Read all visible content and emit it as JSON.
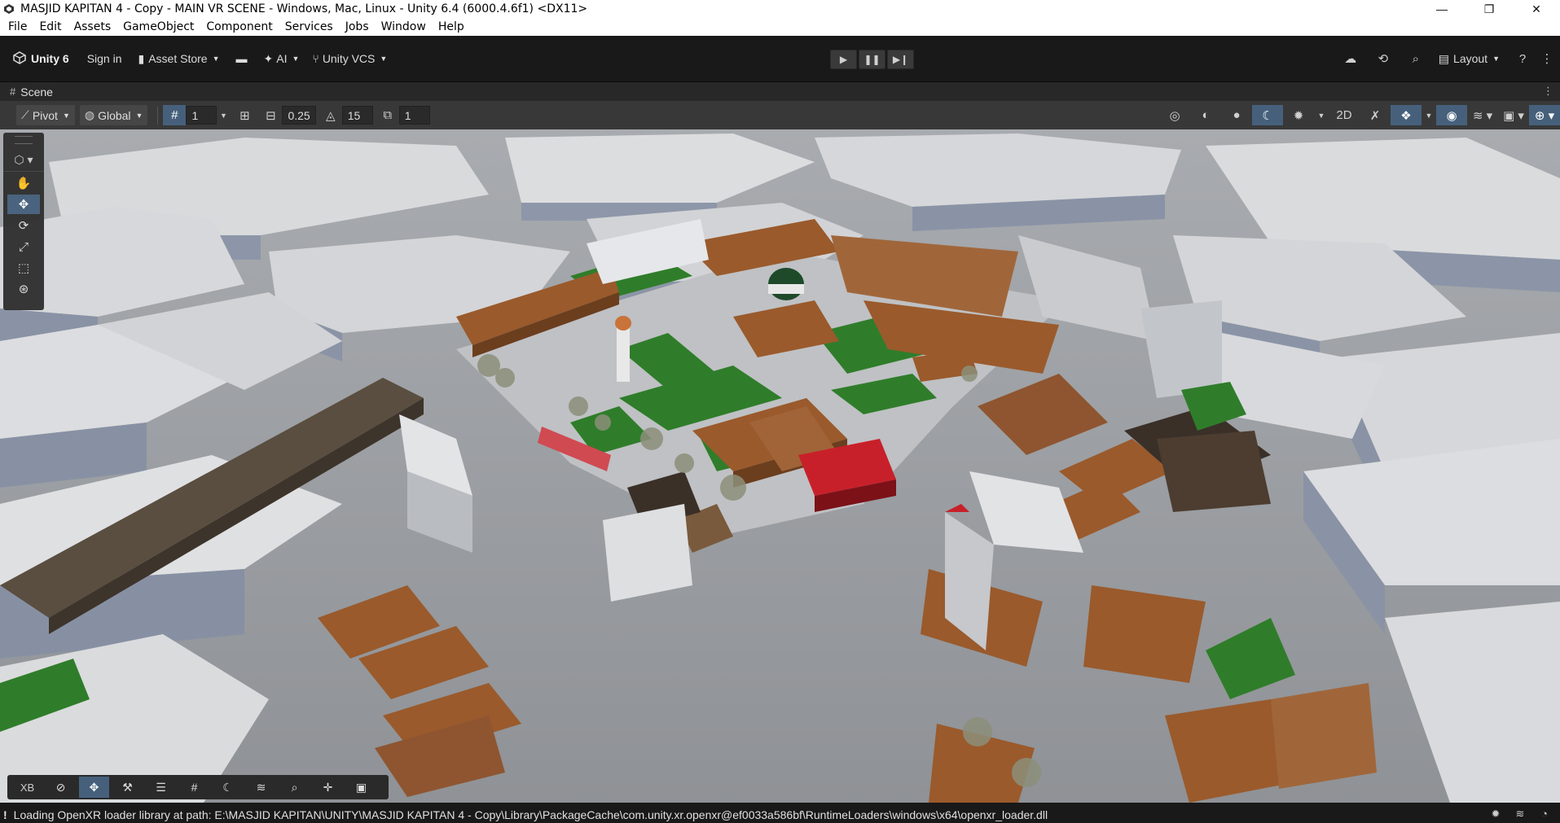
{
  "window": {
    "title": "MASJID KAPITAN 4 - Copy - MAIN VR SCENE - Windows, Mac, Linux - Unity 6.4 (6000.4.6f1) <DX11>",
    "minimize": "—",
    "maximize": "❐",
    "close": "✕"
  },
  "menu": {
    "items": [
      "File",
      "Edit",
      "Assets",
      "GameObject",
      "Component",
      "Services",
      "Jobs",
      "Window",
      "Help"
    ]
  },
  "toolbar": {
    "unity_label": "Unity 6",
    "sign_in": "Sign in",
    "asset_store": "Asset Store",
    "ai": "AI",
    "vcs": "Unity VCS",
    "layout": "Layout"
  },
  "scene": {
    "tab_label": "Scene",
    "pivot": "Pivot",
    "global": "Global",
    "grid_value": "1",
    "move_snap": "0.25",
    "rotate_snap": "15",
    "scale_snap": "1"
  },
  "overlay": {
    "xb_label": "XB"
  },
  "status": {
    "message": "Loading OpenXR loader library at path: E:\\MASJID KAPITAN\\UNITY\\MASJID KAPITAN 4 - Copy\\Library\\PackageCache\\com.unity.xr.openxr@ef0033a586bf\\RuntimeLoaders\\windows\\x64\\openxr_loader.dll"
  },
  "colors": {
    "accent_active": "#46607c",
    "editor_dark": "#191919",
    "toolbar_gray": "#383838",
    "roof_brown": "#9a5a2c",
    "roof_red": "#c8202a",
    "grass_green": "#2f7d2a",
    "dome_green": "#1f4a2a"
  }
}
